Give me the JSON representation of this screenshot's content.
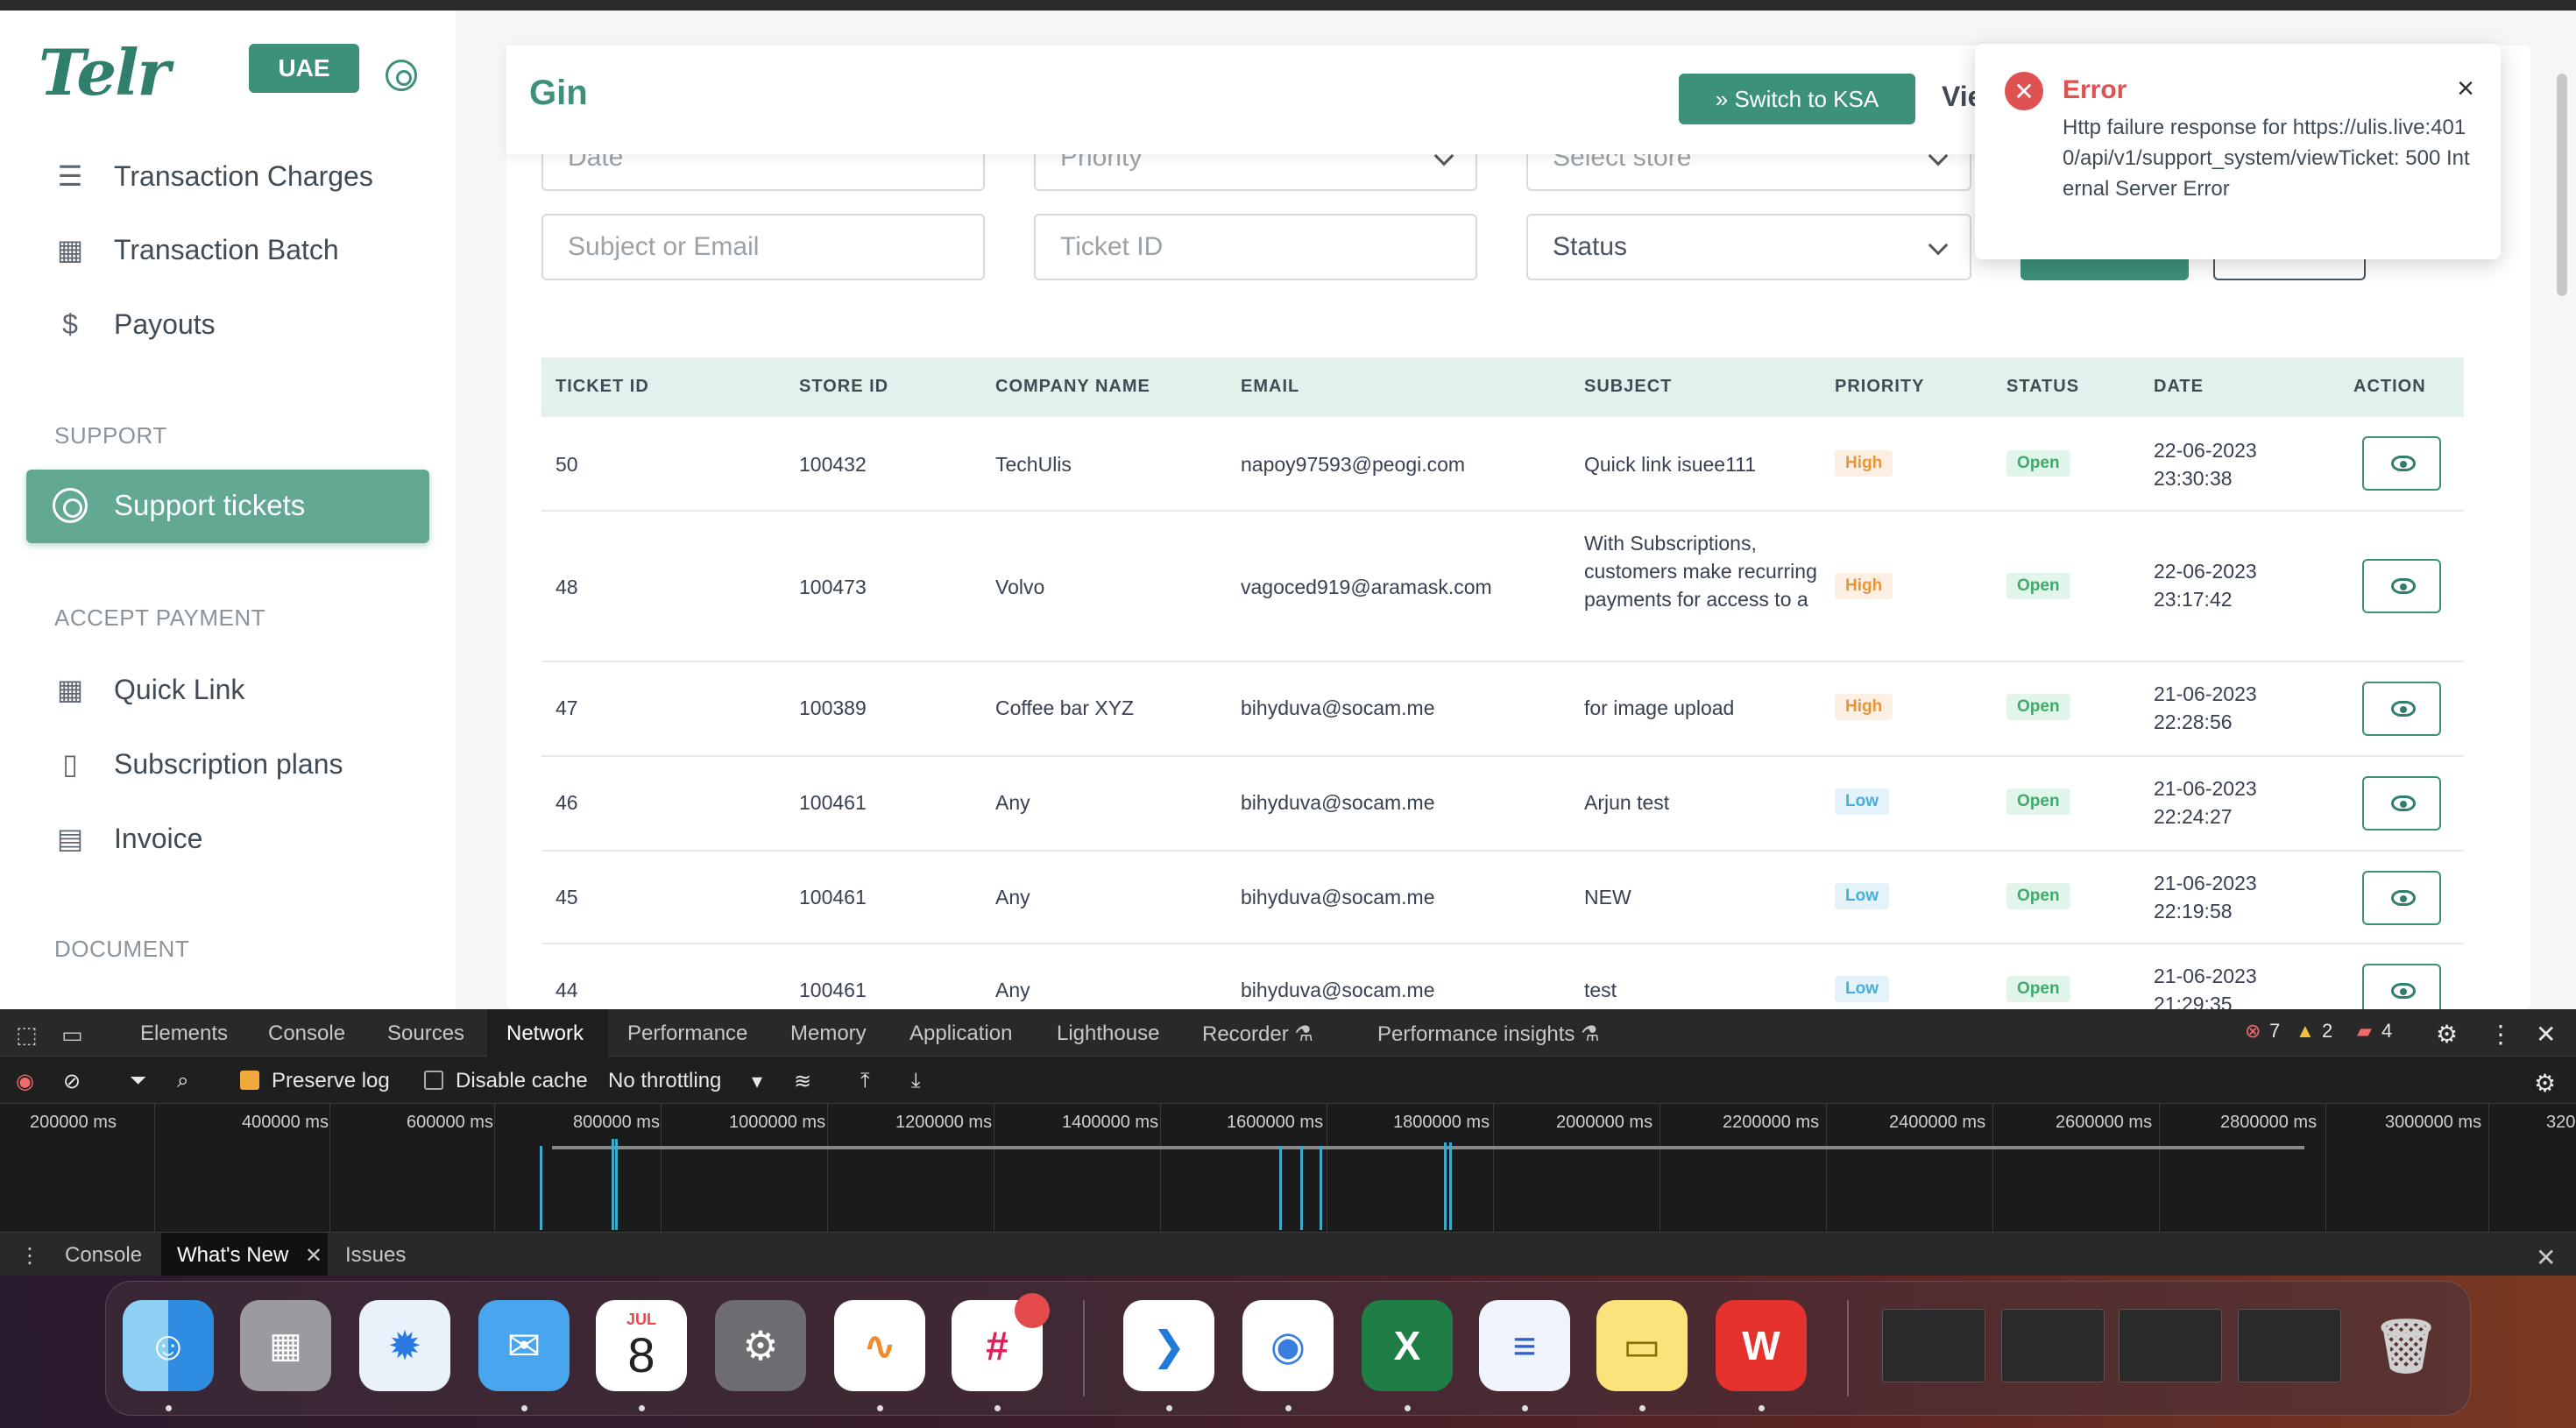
{
  "sidebar": {
    "logo": "Telr",
    "region_button": "UAE",
    "items_top": [
      {
        "label": "Transaction Charges",
        "icon": "list-icon"
      },
      {
        "label": "Transaction Batch",
        "icon": "calendar-icon"
      },
      {
        "label": "Payouts",
        "icon": "dollar-icon"
      }
    ],
    "support_section": "SUPPORT",
    "active_item": "Support tickets",
    "accept_section": "ACCEPT PAYMENT",
    "items_accept": [
      {
        "label": "Quick Link",
        "icon": "grid-icon"
      },
      {
        "label": "Subscription plans",
        "icon": "book-icon"
      },
      {
        "label": "Invoice",
        "icon": "document-icon"
      }
    ],
    "document_section": "DOCUMENT"
  },
  "header": {
    "title": "Gin",
    "switch_button": "» Switch to KSA",
    "view_text": "Vie"
  },
  "filters": {
    "date_placeholder": "Date",
    "priority_placeholder": "Priority",
    "store_placeholder": "Select store",
    "subject_placeholder": "Subject or Email",
    "ticket_placeholder": "Ticket ID",
    "status_placeholder": "Status"
  },
  "table": {
    "headers": [
      "TICKET ID",
      "STORE ID",
      "COMPANY NAME",
      "EMAIL",
      "SUBJECT",
      "PRIORITY",
      "STATUS",
      "DATE",
      "ACTION"
    ],
    "rows": [
      {
        "ticket": "50",
        "store": "100432",
        "company": "TechUlis",
        "email": "napoy97593@peogi.com",
        "subject": "Quick link isuee111",
        "priority": "High",
        "status": "Open",
        "date": "22-06-2023",
        "time": "23:30:38"
      },
      {
        "ticket": "48",
        "store": "100473",
        "company": "Volvo",
        "email": "vagoced919@aramask.com",
        "subject": "With Subscriptions, customers make recurring payments for access to a",
        "priority": "High",
        "status": "Open",
        "date": "22-06-2023",
        "time": "23:17:42"
      },
      {
        "ticket": "47",
        "store": "100389",
        "company": "Coffee bar XYZ",
        "email": "bihyduva@socam.me",
        "subject": "for image upload",
        "priority": "High",
        "status": "Open",
        "date": "21-06-2023",
        "time": "22:28:56"
      },
      {
        "ticket": "46",
        "store": "100461",
        "company": "Any",
        "email": "bihyduva@socam.me",
        "subject": "Arjun test",
        "priority": "Low",
        "status": "Open",
        "date": "21-06-2023",
        "time": "22:24:27"
      },
      {
        "ticket": "45",
        "store": "100461",
        "company": "Any",
        "email": "bihyduva@socam.me",
        "subject": "NEW",
        "priority": "Low",
        "status": "Open",
        "date": "21-06-2023",
        "time": "22:19:58"
      },
      {
        "ticket": "44",
        "store": "100461",
        "company": "Any",
        "email": "bihyduva@socam.me",
        "subject": "test",
        "priority": "Low",
        "status": "Open",
        "date": "21-06-2023",
        "time": "21:29:35"
      }
    ]
  },
  "toast": {
    "title": "Error",
    "message": "Http failure response for https://ulis.live:4010/api/v1/support_system/viewTicket: 500 Internal Server Error",
    "close": "×"
  },
  "devtools": {
    "tabs": [
      "Elements",
      "Console",
      "Sources",
      "Network",
      "Performance",
      "Memory",
      "Application",
      "Lighthouse",
      "Recorder ⚗",
      "Performance insights ⚗"
    ],
    "active_tab": "Network",
    "errors": "7",
    "warnings": "2",
    "issues": "4",
    "preserve_log": "Preserve log",
    "disable_cache": "Disable cache",
    "throttling": "No throttling",
    "ticks": [
      "200000 ms",
      "400000 ms",
      "600000 ms",
      "800000 ms",
      "1000000 ms",
      "1200000 ms",
      "1400000 ms",
      "1600000 ms",
      "1800000 ms",
      "2000000 ms",
      "2200000 ms",
      "2400000 ms",
      "2600000 ms",
      "2800000 ms",
      "3000000 ms",
      "320"
    ],
    "drawer_tabs": [
      "Console",
      "What's New",
      "Issues"
    ]
  },
  "dock": {
    "calendar_month": "JUL",
    "calendar_day": "8",
    "apps": [
      "Finder",
      "Launchpad",
      "Safari",
      "Mail",
      "Calendar",
      "System Settings",
      "Freeform",
      "Slack",
      "VS Code",
      "Chrome",
      "Excel",
      "TextEdit",
      "Notes",
      "WPS Office"
    ]
  }
}
